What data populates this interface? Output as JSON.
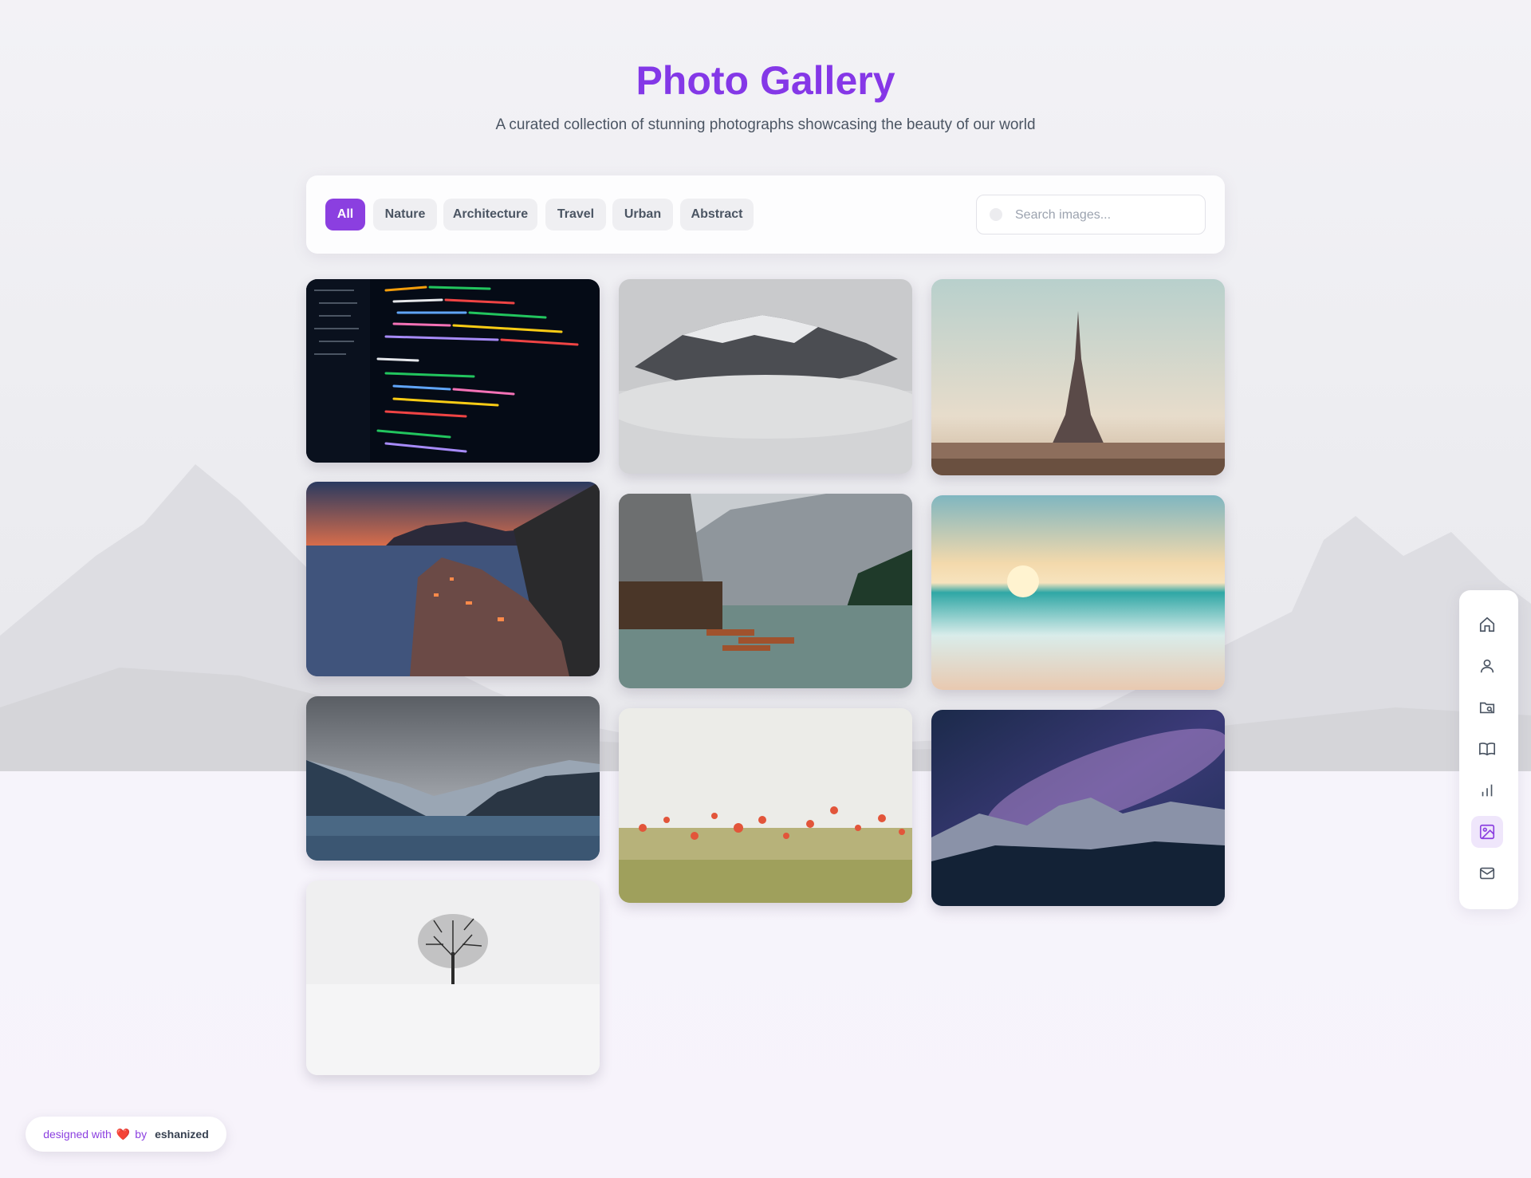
{
  "header": {
    "title": "Photo Gallery",
    "subtitle": "A curated collection of stunning photographs showcasing the beauty of our world"
  },
  "filters": {
    "items": [
      {
        "label": "All",
        "active": true
      },
      {
        "label": "Nature",
        "active": false
      },
      {
        "label": "Architecture",
        "active": false
      },
      {
        "label": "Travel",
        "active": false
      },
      {
        "label": "Urban",
        "active": false
      },
      {
        "label": "Abstract",
        "active": false
      }
    ]
  },
  "search": {
    "placeholder": "Search images...",
    "value": ""
  },
  "gallery": {
    "images": [
      {
        "subject": "code-editor-screen"
      },
      {
        "subject": "misty-mountain-peak"
      },
      {
        "subject": "eiffel-tower"
      },
      {
        "subject": "coastal-village-sunset"
      },
      {
        "subject": "alpine-lake-boathouse"
      },
      {
        "subject": "beach-sunset"
      },
      {
        "subject": "mountain-lake"
      },
      {
        "subject": "poppy-field"
      },
      {
        "subject": "milky-way-mountains"
      },
      {
        "subject": "lone-tree-snow"
      }
    ]
  },
  "sidenav": {
    "items": [
      {
        "icon": "home-icon",
        "active": false
      },
      {
        "icon": "user-icon",
        "active": false
      },
      {
        "icon": "folder-search-icon",
        "active": false
      },
      {
        "icon": "book-icon",
        "active": false
      },
      {
        "icon": "bar-chart-icon",
        "active": false
      },
      {
        "icon": "image-icon",
        "active": true
      },
      {
        "icon": "mail-icon",
        "active": false
      }
    ]
  },
  "footer": {
    "prefix": "designed with",
    "heart": "❤️",
    "by": "by",
    "author": "eshanized"
  },
  "colors": {
    "accent": "#8b3fe0",
    "title": "#7c3aed",
    "text": "#4b5563"
  }
}
